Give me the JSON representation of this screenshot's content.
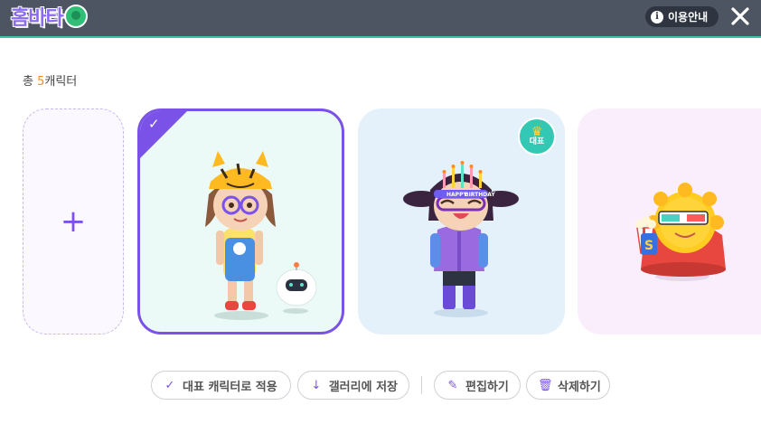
{
  "header": {
    "logo_text": "홈바타",
    "info_label": "이용안내",
    "info_icon": "info-icon",
    "close_icon": "close-icon"
  },
  "count": {
    "prefix": "총 ",
    "number": "5",
    "suffix": "캐릭터"
  },
  "cards": {
    "add_icon": "+",
    "selected_check": "✓",
    "representative_badge": "대표",
    "card2_headband": [
      "HAPPY",
      "BIRTHDAY"
    ]
  },
  "actions": {
    "set_rep": "대표 캐릭터로 적용",
    "save_gallery": "갤러리에 저장",
    "edit": "편집하기",
    "delete": "삭제하기"
  },
  "colors": {
    "accent": "#7b52e8",
    "header_bg": "#4d5563",
    "badge": "#33c8b3",
    "count_number": "#f08b1f"
  }
}
